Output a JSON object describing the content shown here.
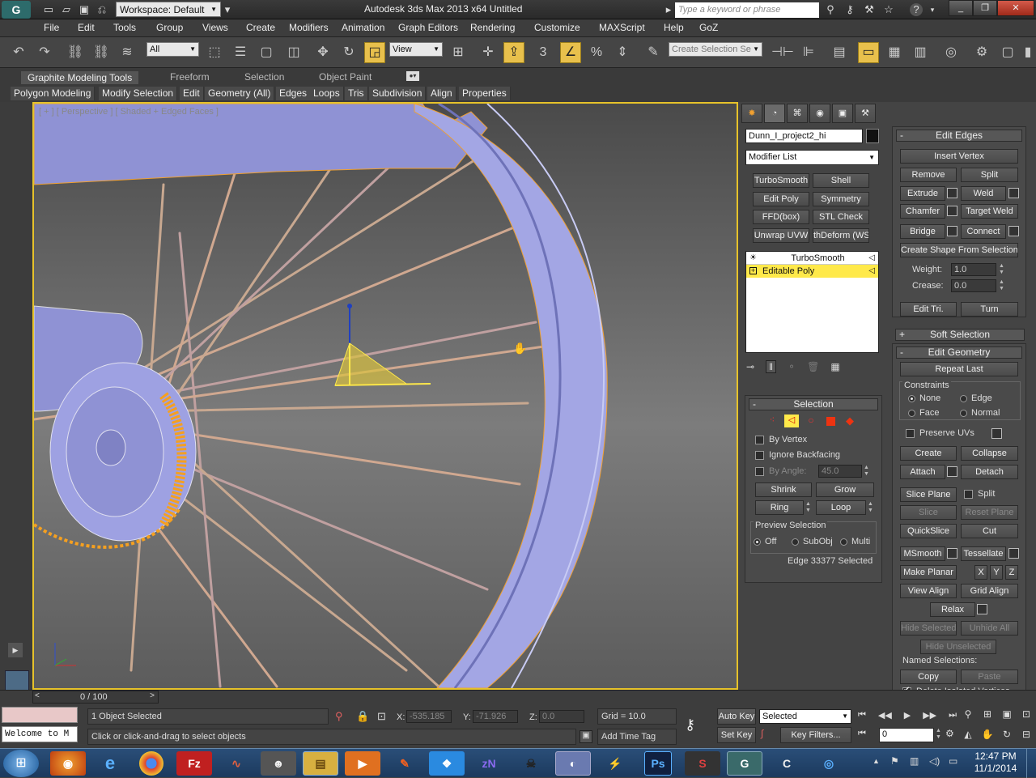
{
  "title_bar": {
    "workspace": "Workspace: Default",
    "title": "Autodesk 3ds Max  2013 x64     Untitled",
    "search_placeholder": "Type a keyword or phrase"
  },
  "menu": [
    "File",
    "Edit",
    "Tools",
    "Group",
    "Views",
    "Create",
    "Modifiers",
    "Animation",
    "Graph Editors",
    "Rendering",
    "Customize",
    "MAXScript",
    "Help",
    "GoZ"
  ],
  "toolbar": {
    "filter": "All",
    "ref_coord": "View",
    "snaps_number": "3",
    "selection_set_placeholder": "Create Selection Se"
  },
  "ribbon": {
    "tabs": [
      "Graphite Modeling Tools",
      "Freeform",
      "Selection",
      "Object Paint"
    ],
    "subtabs": [
      "Polygon Modeling",
      "Modify Selection",
      "Edit",
      "Geometry (All)",
      "Edges",
      "Loops",
      "Tris",
      "Subdivision",
      "Align",
      "Properties"
    ]
  },
  "viewport": {
    "label": "[ + ] [ Perspective ] [ Shaded + Edged Faces ]",
    "cursor_icon": "hand-icon"
  },
  "command_panel": {
    "object_name": "Dunn_I_project2_hi",
    "modifier_list": "Modifier List",
    "modifier_buttons": [
      "TurboSmooth",
      "Shell",
      "Edit Poly",
      "Symmetry",
      "FFD(box)",
      "STL Check",
      "Unwrap UVW",
      "thDeform (WSI"
    ],
    "stack": [
      {
        "label": "TurboSmooth",
        "selected": false
      },
      {
        "label": "Editable Poly",
        "selected": true
      }
    ],
    "selection": {
      "title": "Selection",
      "by_vertex": "By Vertex",
      "ignore_backfacing": "Ignore Backfacing",
      "by_angle": "By Angle:",
      "by_angle_value": "45.0",
      "shrink": "Shrink",
      "grow": "Grow",
      "ring": "Ring",
      "loop": "Loop",
      "preview_title": "Preview Selection",
      "preview_off": "Off",
      "preview_subobj": "SubObj",
      "preview_multi": "Multi",
      "status": "Edge 33377 Selected"
    },
    "edit_edges": {
      "title": "Edit Edges",
      "insert_vertex": "Insert Vertex",
      "remove": "Remove",
      "split": "Split",
      "extrude": "Extrude",
      "weld": "Weld",
      "chamfer": "Chamfer",
      "target_weld": "Target Weld",
      "bridge": "Bridge",
      "connect": "Connect",
      "create_shape": "Create Shape From Selection",
      "weight_label": "Weight:",
      "weight_value": "1.0",
      "crease_label": "Crease:",
      "crease_value": "0.0",
      "edit_tri": "Edit Tri.",
      "turn": "Turn"
    },
    "soft_selection": {
      "title": "Soft Selection"
    },
    "edit_geometry": {
      "title": "Edit Geometry",
      "repeat_last": "Repeat Last",
      "constraints": "Constraints",
      "none": "None",
      "edge": "Edge",
      "face": "Face",
      "normal": "Normal",
      "preserve_uvs": "Preserve UVs",
      "create": "Create",
      "collapse": "Collapse",
      "attach": "Attach",
      "detach": "Detach",
      "slice_plane": "Slice Plane",
      "split": "Split",
      "slice": "Slice",
      "reset_plane": "Reset Plane",
      "quickslice": "QuickSlice",
      "cut": "Cut",
      "msmooth": "MSmooth",
      "tessellate": "Tessellate",
      "make_planar": "Make Planar",
      "x": "X",
      "y": "Y",
      "z": "Z",
      "view_align": "View Align",
      "grid_align": "Grid Align",
      "relax": "Relax",
      "hide_selected": "Hide Selected",
      "unhide_all": "Unhide All",
      "hide_unselected": "Hide Unselected",
      "named_selections": "Named Selections:",
      "copy": "Copy",
      "paste": "Paste",
      "delete_isolated": "Delete Isolated Vertices"
    }
  },
  "status": {
    "timeline": "0 / 100",
    "selected": "1 Object Selected",
    "prompt": "Click or click-and-drag to select objects",
    "listener": "Welcome to M",
    "x_label": "X:",
    "x_value": "-535.185",
    "y_label": "Y:",
    "y_value": "-71.926",
    "z_label": "Z:",
    "z_value": "0.0",
    "grid": "Grid = 10.0",
    "add_time_tag": "Add Time Tag",
    "auto_key": "Auto Key",
    "auto_key_mode": "Selected",
    "set_key": "Set Key",
    "key_filters": "Key Filters...",
    "frame": "0"
  },
  "taskbar": {
    "apps": [
      "firefox",
      "internet-explorer",
      "chrome",
      "filezilla",
      "app5",
      "app6",
      "file-explorer",
      "media-player",
      "app9",
      "dropbox",
      "app11",
      "app12",
      "app13",
      "zbrush",
      "photoshop",
      "substance",
      "3dsmax",
      "app18",
      "app19"
    ],
    "time": "12:47 PM",
    "date": "11/1/2014"
  },
  "colors": {
    "viewport_border": "#e6c22a",
    "selection_highlight": "#ffe94a",
    "wheel": "#9a9ee0",
    "edge_orange": "#f0a030"
  }
}
